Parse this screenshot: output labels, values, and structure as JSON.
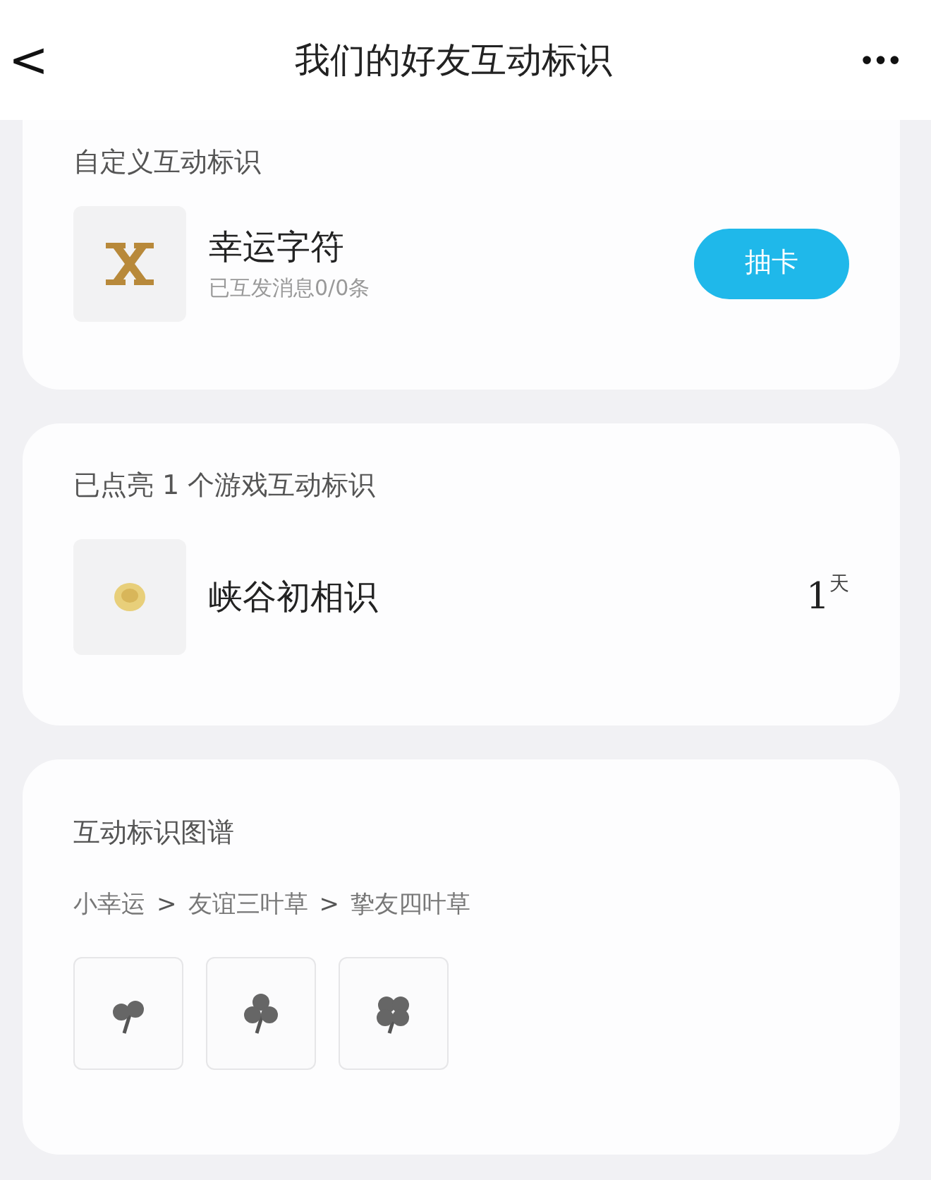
{
  "header": {
    "back": "<",
    "title": "我们的好友互动标识",
    "more": "•••"
  },
  "custom_section": {
    "heading": "自定义互动标识",
    "item": {
      "name": "幸运字符",
      "subtitle": "已互发消息0/0条",
      "button": "抽卡"
    }
  },
  "lit_section": {
    "heading": "已点亮 1 个游戏互动标识",
    "items": [
      {
        "name": "峡谷初相识",
        "days": "1",
        "unit": "天"
      }
    ]
  },
  "atlas_section": {
    "heading": "互动标识图谱",
    "breadcrumb": [
      {
        "kind": "step",
        "text": "小幸运"
      },
      {
        "kind": "separator",
        "text": ">"
      },
      {
        "kind": "step",
        "text": "友谊三叶草"
      },
      {
        "kind": "separator",
        "text": ">"
      },
      {
        "kind": "step",
        "text": "挚友四叶草"
      }
    ],
    "tiles": [
      {
        "kind": "pair"
      },
      {
        "kind": "trefoil"
      },
      {
        "kind": "quatrefoil"
      }
    ]
  }
}
